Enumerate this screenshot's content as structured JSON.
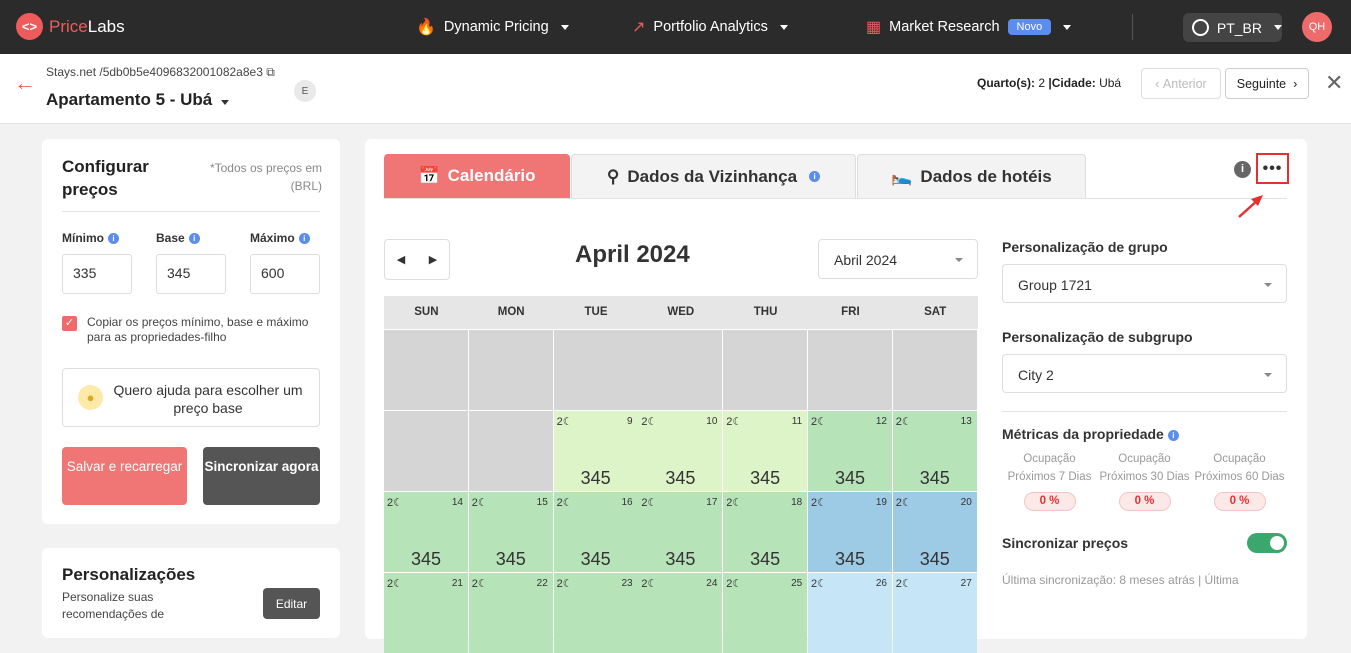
{
  "topbar": {
    "logo_mark": "<>",
    "logo_text_a": "Price",
    "logo_text_b": "Labs",
    "nav": {
      "dynamic_pricing": "Dynamic Pricing",
      "portfolio_analytics": "Portfolio Analytics",
      "market_research": "Market Research",
      "novo_badge": "Novo"
    },
    "language": "PT_BR",
    "avatar": "QH",
    "accent_color": "#ef5b5b"
  },
  "listing": {
    "breadcrumb": "Stays.net /5db0b5e4096832001082a8e3",
    "title": "Apartamento 5 - Ubá",
    "e_chip": "E",
    "meta_rooms_label": "Quarto(s):",
    "meta_rooms_value": "2",
    "meta_city_label": "|Cidade:",
    "meta_city_value": "Ubá",
    "prev_button": "Anterior",
    "next_button": "Seguinte"
  },
  "config": {
    "title_line1": "Configurar",
    "title_line2": "preços",
    "note": "*Todos os preços em (BRL)",
    "min_label": "Mínimo",
    "base_label": "Base",
    "max_label": "Máximo",
    "min_value": "335",
    "base_value": "345",
    "max_value": "600",
    "copy_checkbox_text": "Copiar os preços mínimo, base e máximo para as propriedades-filho",
    "help_text": "Quero ajuda para escolher um preço base",
    "save_button": "Salvar e recarregar",
    "sync_button": "Sincronizar agora"
  },
  "personalizations": {
    "title": "Personalizações",
    "text": "Personalize suas recomendações de",
    "edit_button": "Editar"
  },
  "tabs": {
    "calendar": "Calendário",
    "neighborhood": "Dados da Vizinhança",
    "hotels": "Dados de hotéis"
  },
  "calendar": {
    "month_title": "April 2024",
    "month_select": "Abril 2024",
    "weekdays": [
      "SUN",
      "MON",
      "TUE",
      "WED",
      "THU",
      "FRI",
      "SAT"
    ],
    "rows": [
      [
        {
          "c": "grey"
        },
        {
          "c": "grey"
        },
        {
          "c": "grey"
        },
        {
          "c": "grey"
        },
        {
          "c": "grey"
        },
        {
          "c": "grey"
        },
        {
          "c": "grey"
        }
      ],
      [
        {
          "c": "grey"
        },
        {
          "c": "grey"
        },
        {
          "c": "lg",
          "d": "9",
          "n": "2",
          "p": "345"
        },
        {
          "c": "lg",
          "d": "10",
          "n": "2",
          "p": "345"
        },
        {
          "c": "lg",
          "d": "11",
          "n": "2",
          "p": "345"
        },
        {
          "c": "g",
          "d": "12",
          "n": "2",
          "p": "345"
        },
        {
          "c": "g",
          "d": "13",
          "n": "2",
          "p": "345"
        }
      ],
      [
        {
          "c": "g",
          "d": "14",
          "n": "2",
          "p": "345"
        },
        {
          "c": "g",
          "d": "15",
          "n": "2",
          "p": "345"
        },
        {
          "c": "g",
          "d": "16",
          "n": "2",
          "p": "345"
        },
        {
          "c": "g",
          "d": "17",
          "n": "2",
          "p": "345"
        },
        {
          "c": "g",
          "d": "18",
          "n": "2",
          "p": "345"
        },
        {
          "c": "b",
          "d": "19",
          "n": "2",
          "p": "345"
        },
        {
          "c": "b",
          "d": "20",
          "n": "2",
          "p": "345"
        }
      ],
      [
        {
          "c": "g",
          "d": "21",
          "n": "2",
          "p": ""
        },
        {
          "c": "g",
          "d": "22",
          "n": "2",
          "p": ""
        },
        {
          "c": "g",
          "d": "23",
          "n": "2",
          "p": ""
        },
        {
          "c": "g",
          "d": "24",
          "n": "2",
          "p": ""
        },
        {
          "c": "g",
          "d": "25",
          "n": "2",
          "p": ""
        },
        {
          "c": "lb",
          "d": "26",
          "n": "2",
          "p": ""
        },
        {
          "c": "lb",
          "d": "27",
          "n": "2",
          "p": ""
        }
      ]
    ]
  },
  "right_panel": {
    "group_label": "Personalização de grupo",
    "group_value": "Group 1721",
    "subgroup_label": "Personalização de subgrupo",
    "subgroup_value": "City 2",
    "metrics_label": "Métricas da propriedade",
    "metrics": [
      {
        "label": "Ocupação Próximos 7 Dias",
        "value": "0 %"
      },
      {
        "label": "Ocupação Próximos 30 Dias",
        "value": "0 %"
      },
      {
        "label": "Ocupação Próximos 60 Dias",
        "value": "0 %"
      }
    ],
    "sync_label": "Sincronizar preços",
    "last_sync": "Última sincronização: 8 meses atrás | Última"
  }
}
